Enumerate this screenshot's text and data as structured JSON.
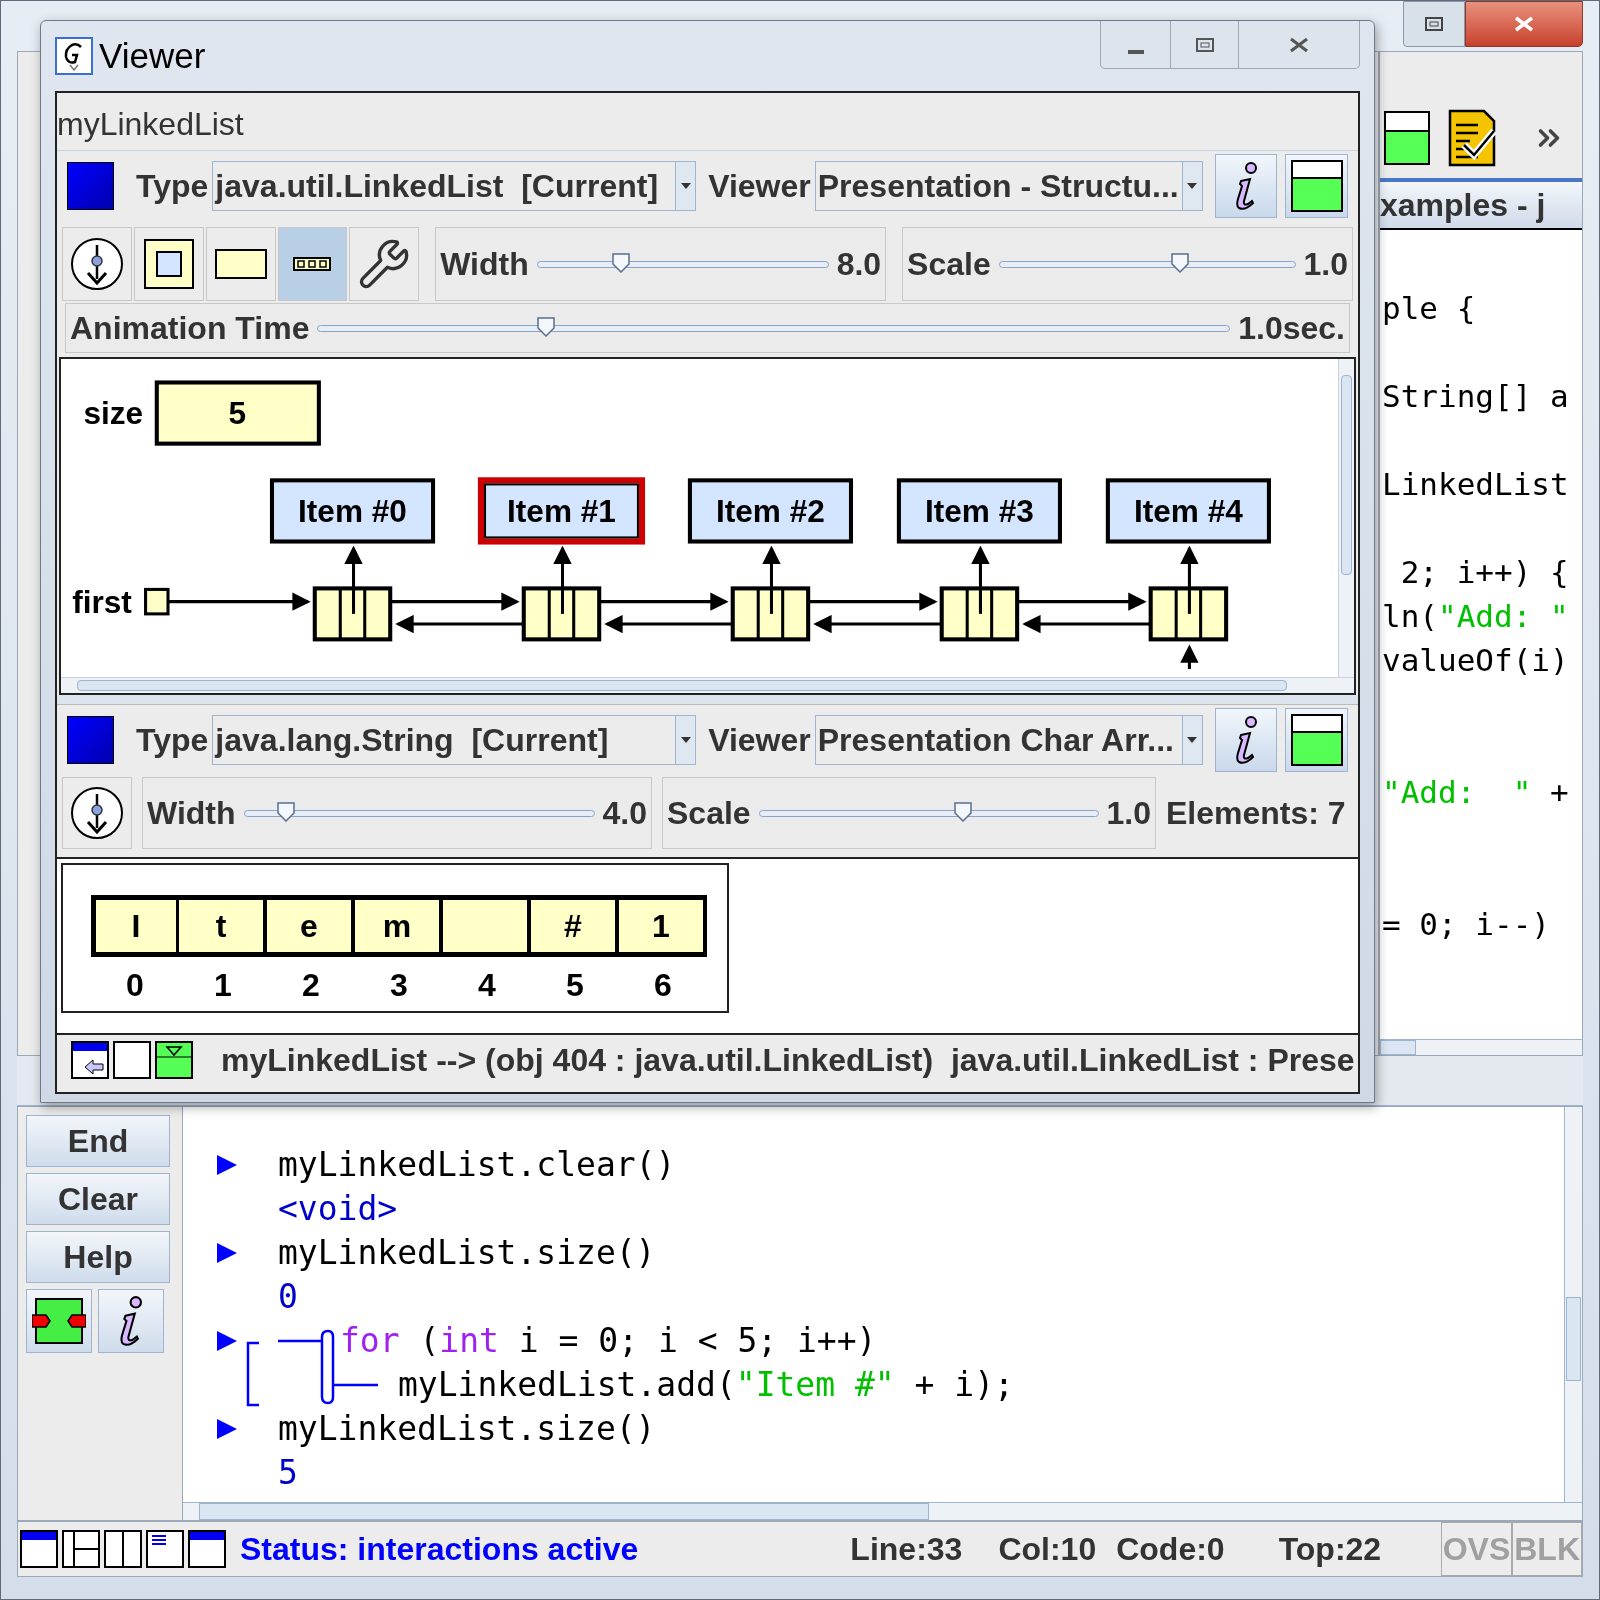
{
  "main_window": {
    "editor_title": "xamples - j",
    "code_lines": [
      {
        "kind": "code",
        "segments": [
          {
            "text": "ple {",
            "kind": "plain"
          }
        ]
      },
      {
        "kind": "blank"
      },
      {
        "kind": "code",
        "segments": [
          {
            "text": "String[] a",
            "kind": "plain"
          }
        ]
      },
      {
        "kind": "blank"
      },
      {
        "kind": "code",
        "segments": [
          {
            "text": "LinkedList",
            "kind": "plain"
          }
        ]
      },
      {
        "kind": "blank"
      },
      {
        "kind": "code",
        "segments": [
          {
            "text": " 2; i++) {",
            "kind": "plain"
          }
        ]
      },
      {
        "kind": "code",
        "segments": [
          {
            "text": "ln(",
            "kind": "plain"
          },
          {
            "text": "\"Add: \"",
            "kind": "string"
          }
        ]
      },
      {
        "kind": "code",
        "segments": [
          {
            "text": "valueOf(i)",
            "kind": "plain"
          }
        ]
      },
      {
        "kind": "blank"
      },
      {
        "kind": "blank"
      },
      {
        "kind": "code",
        "segments": [
          {
            "text": "\"Add:  \"",
            "kind": "string"
          },
          {
            "text": " +",
            "kind": "plain"
          }
        ]
      },
      {
        "kind": "blank"
      },
      {
        "kind": "blank"
      },
      {
        "kind": "code",
        "segments": [
          {
            "text": "= 0; i--)",
            "kind": "plain"
          }
        ]
      }
    ],
    "interactions": {
      "buttons": [
        "End",
        "Clear",
        "Help"
      ],
      "entries": [
        {
          "kind": "input",
          "segments": [
            {
              "text": "myLinkedList.clear()",
              "kind": "plain"
            }
          ]
        },
        {
          "kind": "output",
          "text": "<void>"
        },
        {
          "kind": "input",
          "segments": [
            {
              "text": "myLinkedList.size()",
              "kind": "plain"
            }
          ]
        },
        {
          "kind": "output",
          "text": "0"
        },
        {
          "kind": "block",
          "lines": [
            [
              {
                "text": "for",
                "kind": "keyword"
              },
              {
                "text": " (",
                "kind": "plain"
              },
              {
                "text": "int",
                "kind": "keyword"
              },
              {
                "text": " i = 0; i < 5; i++)",
                "kind": "plain"
              }
            ],
            [
              {
                "text": "myLinkedList.add(",
                "kind": "plain"
              },
              {
                "text": "\"Item #\"",
                "kind": "string"
              },
              {
                "text": " + i);",
                "kind": "plain"
              }
            ]
          ]
        },
        {
          "kind": "input",
          "segments": [
            {
              "text": "myLinkedList.size()",
              "kind": "plain"
            }
          ]
        },
        {
          "kind": "output",
          "text": "5"
        }
      ]
    },
    "status_bar": {
      "status": "Status: interactions active",
      "line": "Line:33",
      "col": "Col:10",
      "code": "Code:0",
      "top": "Top:22",
      "modes": [
        {
          "label": "OVS",
          "active": false
        },
        {
          "label": "BLK",
          "active": false
        }
      ]
    }
  },
  "viewer": {
    "title": "Viewer",
    "object_name": "myLinkedList",
    "panels": [
      {
        "type_label": "Type",
        "type_value": "java.util.LinkedList  [Current]",
        "viewer_label": "Viewer",
        "viewer_value": "Presentation - Structu...",
        "tools": [
          {
            "kind": "step",
            "selected": false
          },
          {
            "kind": "box",
            "selected": false
          },
          {
            "kind": "rect",
            "selected": false
          },
          {
            "kind": "dots",
            "selected": true
          },
          {
            "kind": "wrench",
            "selected": false
          }
        ],
        "sliders": [
          {
            "label": "Width",
            "level": 0.29,
            "reading": "8.0"
          },
          {
            "label": "Scale",
            "level": 0.61,
            "reading": "1.0"
          }
        ],
        "animation": {
          "label": "Animation Time",
          "level": 0.25,
          "reading": "1.0sec."
        },
        "diagram": {
          "size_label": "size",
          "size_value": "5",
          "head_label": "first",
          "items": [
            {
              "label": "Item #0",
              "selected": false
            },
            {
              "label": "Item #1",
              "selected": true
            },
            {
              "label": "Item #2",
              "selected": false
            },
            {
              "label": "Item #3",
              "selected": false
            },
            {
              "label": "Item #4",
              "selected": false
            }
          ]
        }
      },
      {
        "type_label": "Type",
        "type_value": "java.lang.String  [Current]",
        "viewer_label": "Viewer",
        "viewer_value": "Presentation Char Arr...",
        "tools": [
          {
            "kind": "step",
            "selected": false
          }
        ],
        "sliders": [
          {
            "label": "Width",
            "level": 0.12,
            "reading": "4.0"
          },
          {
            "label": "Scale",
            "level": 0.6,
            "reading": "1.0"
          }
        ],
        "elements": "Elements: 7",
        "array": {
          "cells": [
            {
              "char": "I",
              "index": "0"
            },
            {
              "char": "t",
              "index": "1"
            },
            {
              "char": "e",
              "index": "2"
            },
            {
              "char": "m",
              "index": "3"
            },
            {
              "index": "4"
            },
            {
              "char": "#",
              "index": "5"
            },
            {
              "char": "1",
              "index": "6"
            }
          ]
        }
      }
    ],
    "status": "myLinkedList --> (obj 404 : java.util.LinkedList)  java.util.LinkedList : Prese"
  }
}
